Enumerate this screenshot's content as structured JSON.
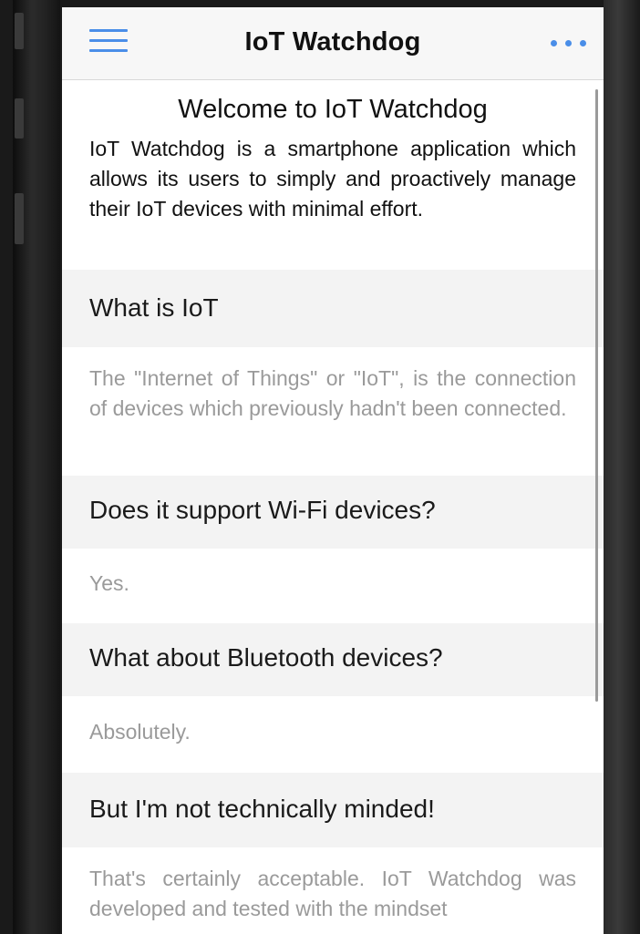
{
  "app": {
    "title": "IoT Watchdog",
    "accent_color": "#4a8ee8",
    "menu_icon": "hamburger-menu-icon",
    "more_icon": "more-horizontal-icon"
  },
  "welcome": {
    "title": "Welcome to IoT Watchdog",
    "intro": "IoT Watchdog is a smartphone application which allows its users to simply and proactively manage their IoT devices with minimal effort."
  },
  "faq": [
    {
      "question": "What is IoT",
      "answer": "The \"Internet of Things\" or \"IoT\", is the connection of devices which previously hadn't been connected."
    },
    {
      "question": "Does it support Wi-Fi devices?",
      "answer": "Yes."
    },
    {
      "question": "What about Bluetooth devices?",
      "answer": "Absolutely."
    },
    {
      "question": "But I'm not technically minded!",
      "answer": "That's certainly acceptable. IoT Watchdog was developed and tested with the mindset"
    }
  ]
}
